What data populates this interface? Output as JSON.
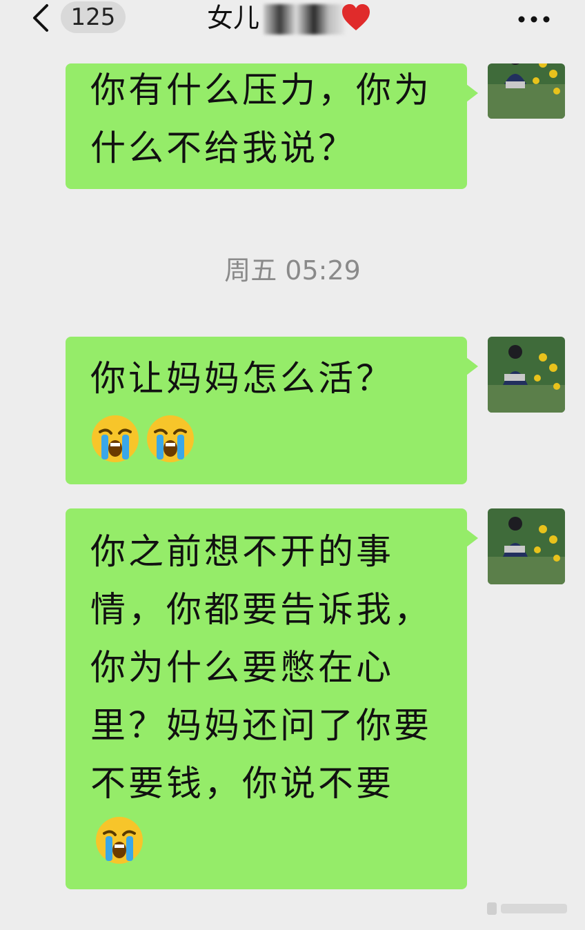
{
  "header": {
    "back_icon": "chevron-left-icon",
    "unread_count": "125",
    "title_visible": "女儿",
    "title_emoji": "red-heart-icon",
    "more_icon": "ellipsis-icon"
  },
  "messages": [
    {
      "text": "你有什么压力，你为什么不给我说？",
      "emojis": 0
    },
    {
      "text": "你让妈妈怎么活？",
      "emojis": 2
    },
    {
      "text": "你之前想不开的事情，你都要告诉我，你为什么要憋在心里？妈妈还问了你要不要钱，你说不要",
      "emojis": 1
    }
  ],
  "timestamp": "周五 05:29",
  "colors": {
    "background": "#ededed",
    "bubble": "#95ec69",
    "timestamp": "#8a8a8a"
  },
  "emoji_icon": "loudly-crying-face-icon"
}
